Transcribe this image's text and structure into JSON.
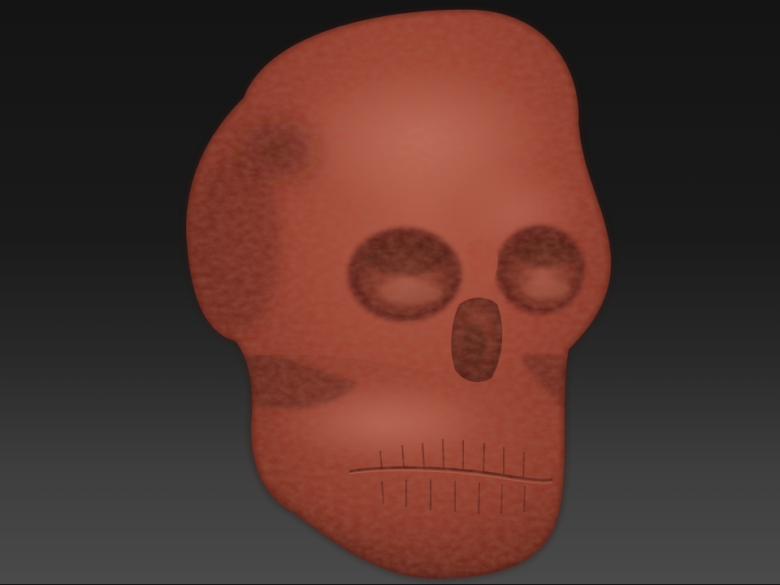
{
  "scene": {
    "subject": "sculpted-skull-model",
    "colors": {
      "background_top": "#141414",
      "background_bottom": "#4a4a4a",
      "clay_base": "#9a3c2c",
      "clay_light": "#c06a57",
      "clay_shadow": "#5a1f16",
      "clay_deep": "#3e140e"
    }
  }
}
